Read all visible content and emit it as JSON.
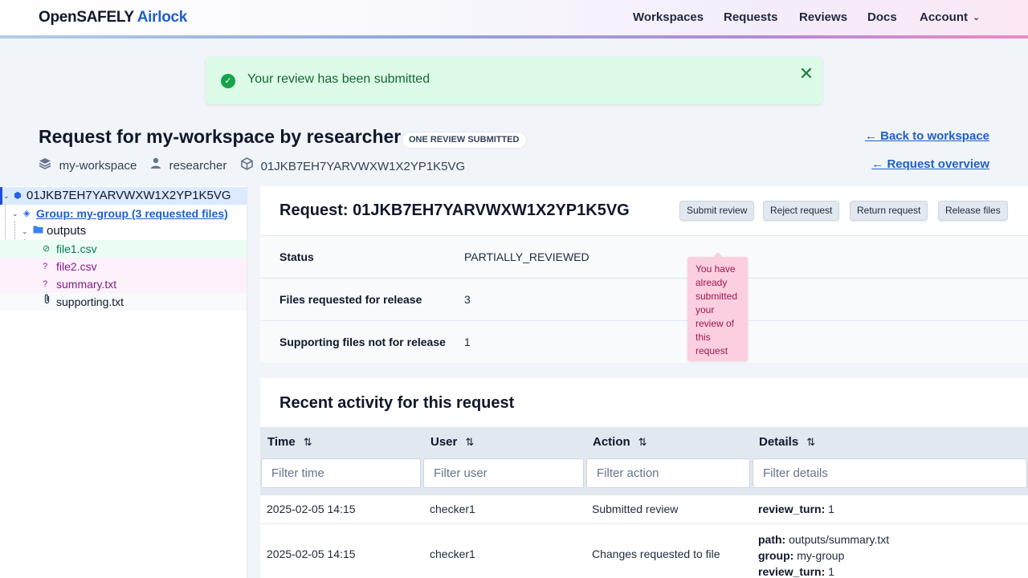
{
  "header": {
    "brand_prefix": "OpenSAFELY",
    "brand_suffix": "Airlock",
    "nav": [
      "Workspaces",
      "Requests",
      "Reviews",
      "Docs",
      "Account"
    ]
  },
  "flash": {
    "message": "Your review has been submitted",
    "close_icon": "close-icon"
  },
  "page": {
    "title": "Request for my-workspace by researcher",
    "status_pill": "ONE REVIEW SUBMITTED",
    "workspace": "my-workspace",
    "user": "researcher",
    "request_id": "01JKB7EH7YARVWXW1X2YP1K5VG",
    "back_link": "← Back to workspace",
    "overview_link": "← Request overview"
  },
  "tree": {
    "root": "01JKB7EH7YARVWXW1X2YP1K5VG",
    "group": "Group: my-group (3 requested files)",
    "folder": "outputs",
    "files": [
      {
        "name": "file1.csv",
        "state": "approved"
      },
      {
        "name": "file2.csv",
        "state": "pending"
      },
      {
        "name": "summary.txt",
        "state": "pending"
      },
      {
        "name": "supporting.txt",
        "state": "supporting"
      }
    ]
  },
  "request": {
    "title": "Request: 01JKB7EH7YARVWXW1X2YP1K5VG",
    "buttons": [
      "Submit review",
      "Reject request",
      "Return request",
      "Release files"
    ],
    "rows": [
      {
        "key": "Status",
        "value": "PARTIALLY_REVIEWED"
      },
      {
        "key": "Files requested for release",
        "value": "3"
      },
      {
        "key": "Supporting files not for release",
        "value": "1"
      }
    ],
    "tooltip": "You have already submitted your review of this request"
  },
  "activity": {
    "title": "Recent activity for this request",
    "columns": [
      "Time",
      "User",
      "Action",
      "Details"
    ],
    "filters": [
      "Filter time",
      "Filter user",
      "Filter action",
      "Filter details"
    ],
    "rows": [
      {
        "time": "2025-02-05 14:15",
        "user": "checker1",
        "action": "Submitted review",
        "details": [
          {
            "k": "review_turn:",
            "v": "1"
          }
        ]
      },
      {
        "time": "2025-02-05 14:15",
        "user": "checker1",
        "action": "Changes requested to file",
        "details": [
          {
            "k": "path:",
            "v": "outputs/summary.txt"
          },
          {
            "k": "group:",
            "v": "my-group"
          },
          {
            "k": "review_turn:",
            "v": "1"
          }
        ]
      }
    ]
  },
  "colors": {
    "accent": "#1d5fcc",
    "approved_bg": "#ecfdf5",
    "approved_fg": "#047857",
    "pending_bg": "#fdf2fb",
    "pending_fg": "#86198f",
    "tooltip_bg": "#fbcfe0"
  }
}
